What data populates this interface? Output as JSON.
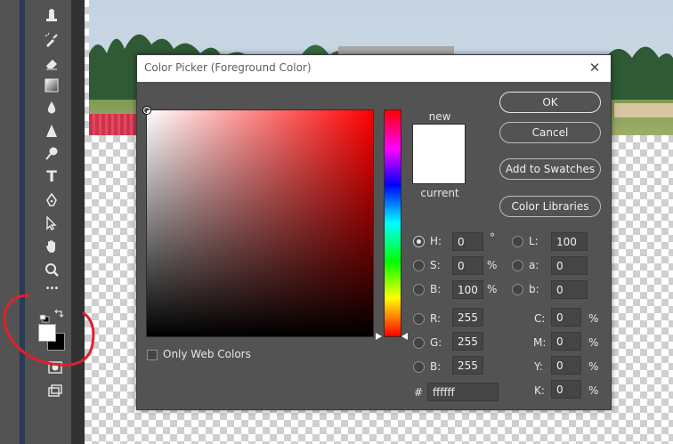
{
  "dialog": {
    "title": "Color Picker (Foreground Color)",
    "close_glyph": "✕",
    "new_label": "new",
    "current_label": "current",
    "buttons": {
      "ok": "OK",
      "cancel": "Cancel",
      "add_to_swatches": "Add to Swatches",
      "color_libraries": "Color Libraries"
    },
    "hsb": {
      "h": {
        "label": "H:",
        "value": "0",
        "unit": "°"
      },
      "s": {
        "label": "S:",
        "value": "0",
        "unit": "%"
      },
      "b": {
        "label": "B:",
        "value": "100",
        "unit": "%"
      }
    },
    "rgb": {
      "r": {
        "label": "R:",
        "value": "255"
      },
      "g": {
        "label": "G:",
        "value": "255"
      },
      "b": {
        "label": "B:",
        "value": "255"
      }
    },
    "lab": {
      "l": {
        "label": "L:",
        "value": "100"
      },
      "a": {
        "label": "a:",
        "value": "0"
      },
      "b": {
        "label": "b:",
        "value": "0"
      }
    },
    "cmyk": {
      "c": {
        "label": "C:",
        "value": "0",
        "unit": "%"
      },
      "m": {
        "label": "M:",
        "value": "0",
        "unit": "%"
      },
      "y": {
        "label": "Y:",
        "value": "0",
        "unit": "%"
      },
      "k": {
        "label": "K:",
        "value": "0",
        "unit": "%"
      }
    },
    "hex": {
      "label": "#",
      "value": "ffffff"
    },
    "only_web_colors": "Only Web Colors",
    "selected_color": "#ffffff",
    "hue_color": "#ff0000"
  },
  "toolbar": {
    "tools": [
      "stamp-icon",
      "history-brush-icon",
      "eraser-icon",
      "gradient-icon",
      "blur-icon",
      "sharpen-icon",
      "dodge-icon",
      "type-icon",
      "pen-icon",
      "path-selection-icon",
      "hand-icon",
      "zoom-icon",
      "more-icon"
    ],
    "foreground_color": "#ffffff",
    "background_color": "#000000",
    "type_glyph": "T",
    "more_glyph": "•••"
  },
  "annotation": {
    "color": "#e0202a"
  }
}
